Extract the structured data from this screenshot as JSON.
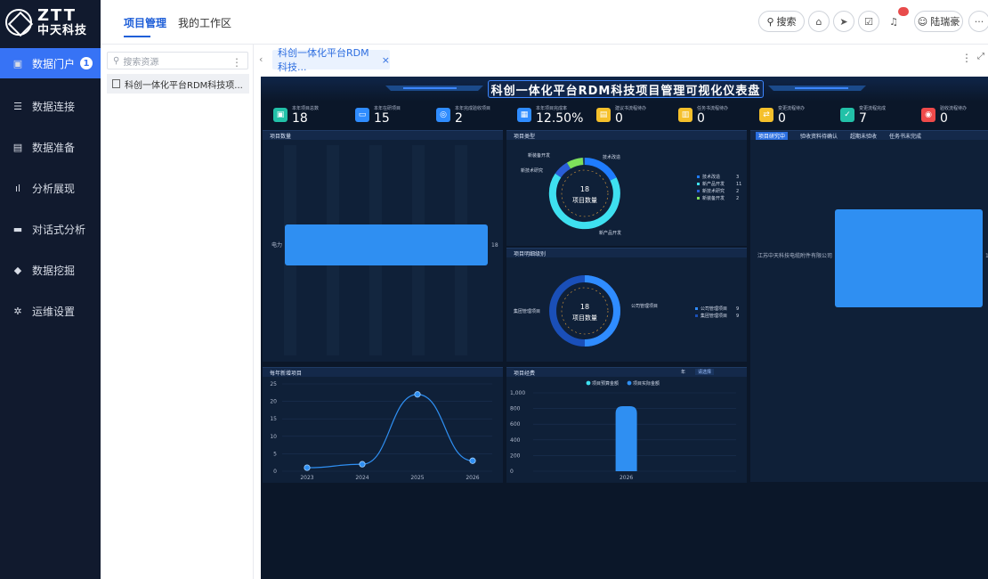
{
  "brand": {
    "logo_big": "ZTT",
    "logo_small": "中天科技"
  },
  "nav": {
    "items": [
      {
        "label": "数据门户",
        "badge": "1",
        "icon": "portal-icon",
        "active": true
      },
      {
        "label": "数据连接",
        "icon": "database-icon"
      },
      {
        "label": "数据准备",
        "icon": "server-icon"
      },
      {
        "label": "分析展现",
        "icon": "bar-chart-icon"
      },
      {
        "label": "对话式分析",
        "icon": "chat-icon"
      },
      {
        "label": "数据挖掘",
        "icon": "pick-icon"
      },
      {
        "label": "运维设置",
        "icon": "gear-icon"
      }
    ]
  },
  "topbar": {
    "tabs": [
      {
        "label": "项目管理",
        "active": true
      },
      {
        "label": "我的工作区"
      }
    ],
    "search_label": "搜索",
    "user_name": "陆瑞豪"
  },
  "resources": {
    "search_placeholder": "搜索资源",
    "items": [
      {
        "label": "科创一体化平台RDM科技项..."
      }
    ]
  },
  "content_tabs": [
    {
      "label": "科创一体化平台RDM科技..."
    }
  ],
  "dashboard": {
    "title": "科创一体化平台RDM科技项目管理可视化仪表盘",
    "kpis": [
      {
        "label": "本年项目总数",
        "value": "18",
        "color": "#22c1a8"
      },
      {
        "label": "本年在研项目",
        "value": "15",
        "color": "#2f8cff"
      },
      {
        "label": "本年完成验收项目",
        "value": "2",
        "color": "#2f8cff"
      },
      {
        "label": "本年项目完成率",
        "value": "12.50%",
        "color": "#2f8cff"
      },
      {
        "label": "建议书流程待办",
        "value": "0",
        "color": "#f5c02b"
      },
      {
        "label": "任务书流程待办",
        "value": "0",
        "color": "#f5c02b"
      },
      {
        "label": "变更流程待办",
        "value": "0",
        "color": "#f5c02b"
      },
      {
        "label": "变更流程完成",
        "value": "7",
        "color": "#22c1a8"
      },
      {
        "label": "验收流程待办",
        "value": "0",
        "color": "#ef4a4a"
      }
    ],
    "project_count_panel": {
      "title": "项目数量",
      "category": "电力",
      "value": "18"
    },
    "project_type_panel": {
      "title": "项目类型",
      "center_value": "18",
      "center_label": "项目数量",
      "slices": [
        {
          "name": "技术改造",
          "value": 3,
          "color": "#1f7cff"
        },
        {
          "name": "新产品开发",
          "value": 11,
          "color": "#3ee0f0"
        },
        {
          "name": "新技术研究",
          "value": 2,
          "color": "#2a5ed8"
        },
        {
          "name": "新装备开发",
          "value": 2,
          "color": "#7ee05b"
        }
      ]
    },
    "project_level_panel": {
      "title": "项目明细级别",
      "center_value": "18",
      "center_label": "项目数量",
      "slices": [
        {
          "name": "公司管理项目",
          "value": 9,
          "color": "#2f8cff"
        },
        {
          "name": "集团管理项目",
          "value": 9,
          "color": "#1a4fb8"
        }
      ]
    },
    "org_panel": {
      "tabs": [
        "项目研究中",
        "验收资料待确认",
        "超期未验收",
        "任务书未完成"
      ],
      "category": "江苏中天科技电缆附件有限公司",
      "value": "1"
    },
    "yearly_panel": {
      "title": "每年新增项目"
    },
    "funds_panel": {
      "title": "项目经费",
      "filter_label": "年",
      "filter_value": "请选择",
      "legend": [
        "项目预算金额",
        "项目实际金额"
      ]
    }
  },
  "chart_data": [
    {
      "type": "line",
      "title": "每年新增项目",
      "x": [
        "2023",
        "2024",
        "2025",
        "2026"
      ],
      "series": [
        {
          "values": [
            1,
            2,
            22,
            3
          ]
        }
      ],
      "ylim": [
        0,
        25
      ],
      "yticks": [
        0,
        5,
        10,
        15,
        20,
        25
      ]
    },
    {
      "type": "bar",
      "title": "项目经费",
      "categories": [
        "2026"
      ],
      "series": [
        {
          "name": "项目预算金额",
          "values": [
            0
          ]
        },
        {
          "name": "项目实际金额",
          "values": [
            830
          ]
        }
      ],
      "ylim": [
        0,
        1000
      ],
      "yticks": [
        0,
        200,
        400,
        600,
        800,
        "1,000"
      ]
    }
  ]
}
